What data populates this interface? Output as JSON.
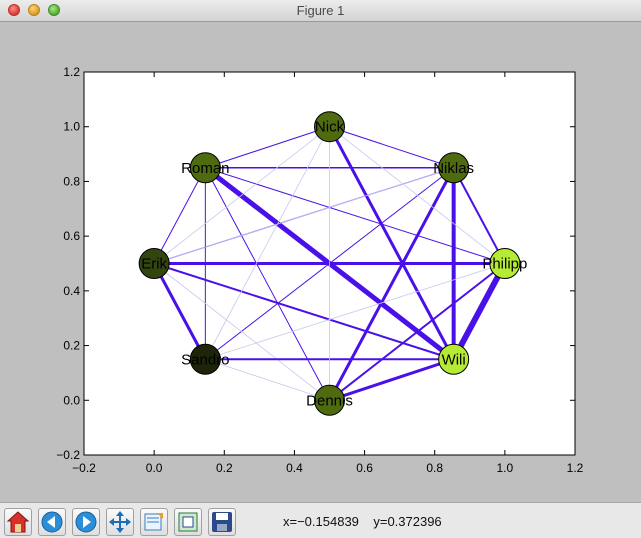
{
  "window": {
    "title": "Figure 1"
  },
  "chart_data": {
    "type": "network",
    "xlim": [
      -0.2,
      1.2
    ],
    "ylim": [
      -0.2,
      1.2
    ],
    "x_ticks": [
      "−0.2",
      "0.0",
      "0.2",
      "0.4",
      "0.6",
      "0.8",
      "1.0",
      "1.2"
    ],
    "y_ticks": [
      "−0.2",
      "0.0",
      "0.2",
      "0.4",
      "0.6",
      "0.8",
      "1.0",
      "1.2"
    ],
    "edge_color": "#4a10e8",
    "faint_edge_color": "#c8c8ee",
    "nodes": [
      {
        "name": "Nick",
        "x": 0.5,
        "y": 1.0,
        "color": "#4f6b10"
      },
      {
        "name": "Niklas",
        "x": 0.854,
        "y": 0.85,
        "color": "#4f6b10"
      },
      {
        "name": "Philipp",
        "x": 1.0,
        "y": 0.5,
        "color": "#b5ea35"
      },
      {
        "name": "Wili",
        "x": 0.854,
        "y": 0.15,
        "color": "#b5ea35"
      },
      {
        "name": "Dennis",
        "x": 0.5,
        "y": 0.0,
        "color": "#4f6b10"
      },
      {
        "name": "Sandro",
        "x": 0.146,
        "y": 0.15,
        "color": "#1c250a"
      },
      {
        "name": "Erik",
        "x": 0.0,
        "y": 0.5,
        "color": "#33450f"
      },
      {
        "name": "Roman",
        "x": 0.146,
        "y": 0.85,
        "color": "#4f6b10"
      }
    ],
    "edges": [
      {
        "source": "Nick",
        "target": "Niklas",
        "weight": 1
      },
      {
        "source": "Nick",
        "target": "Roman",
        "weight": 1
      },
      {
        "source": "Nick",
        "target": "Wili",
        "weight": 3
      },
      {
        "source": "Roman",
        "target": "Niklas",
        "weight": 1.5
      },
      {
        "source": "Roman",
        "target": "Erik",
        "weight": 1
      },
      {
        "source": "Roman",
        "target": "Sandro",
        "weight": 1
      },
      {
        "source": "Roman",
        "target": "Philipp",
        "weight": 1
      },
      {
        "source": "Roman",
        "target": "Wili",
        "weight": 5
      },
      {
        "source": "Roman",
        "target": "Dennis",
        "weight": 1
      },
      {
        "source": "Niklas",
        "target": "Philipp",
        "weight": 2
      },
      {
        "source": "Niklas",
        "target": "Wili",
        "weight": 4
      },
      {
        "source": "Niklas",
        "target": "Dennis",
        "weight": 3
      },
      {
        "source": "Niklas",
        "target": "Sandro",
        "weight": 1
      },
      {
        "source": "Niklas",
        "target": "Erik",
        "weight": 1
      },
      {
        "source": "Erik",
        "target": "Philipp",
        "weight": 3
      },
      {
        "source": "Erik",
        "target": "Wili",
        "weight": 2
      },
      {
        "source": "Erik",
        "target": "Sandro",
        "weight": 3
      },
      {
        "source": "Erik",
        "target": "Dennis",
        "weight": 0.4
      },
      {
        "source": "Erik",
        "target": "Nick",
        "weight": 0.4
      },
      {
        "source": "Erik",
        "target": "Niklas",
        "weight": 0.4
      },
      {
        "source": "Sandro",
        "target": "Wili",
        "weight": 2
      },
      {
        "source": "Sandro",
        "target": "Dennis",
        "weight": 0.4
      },
      {
        "source": "Sandro",
        "target": "Philipp",
        "weight": 0.4
      },
      {
        "source": "Philipp",
        "target": "Wili",
        "weight": 6
      },
      {
        "source": "Philipp",
        "target": "Dennis",
        "weight": 2
      },
      {
        "source": "Philipp",
        "target": "Nick",
        "weight": 0.4
      },
      {
        "source": "Wili",
        "target": "Dennis",
        "weight": 3
      },
      {
        "source": "Nick",
        "target": "Dennis",
        "weight": 0.4
      },
      {
        "source": "Nick",
        "target": "Sandro",
        "weight": 0.4
      }
    ]
  },
  "toolbar": {
    "buttons": [
      {
        "icon": "home-icon"
      },
      {
        "icon": "back-icon"
      },
      {
        "icon": "forward-icon"
      },
      {
        "icon": "pan-icon"
      },
      {
        "icon": "zoom-rect-icon"
      },
      {
        "icon": "subplots-icon"
      },
      {
        "icon": "save-icon"
      }
    ],
    "coords": "x=−0.154839    y=0.372396"
  }
}
